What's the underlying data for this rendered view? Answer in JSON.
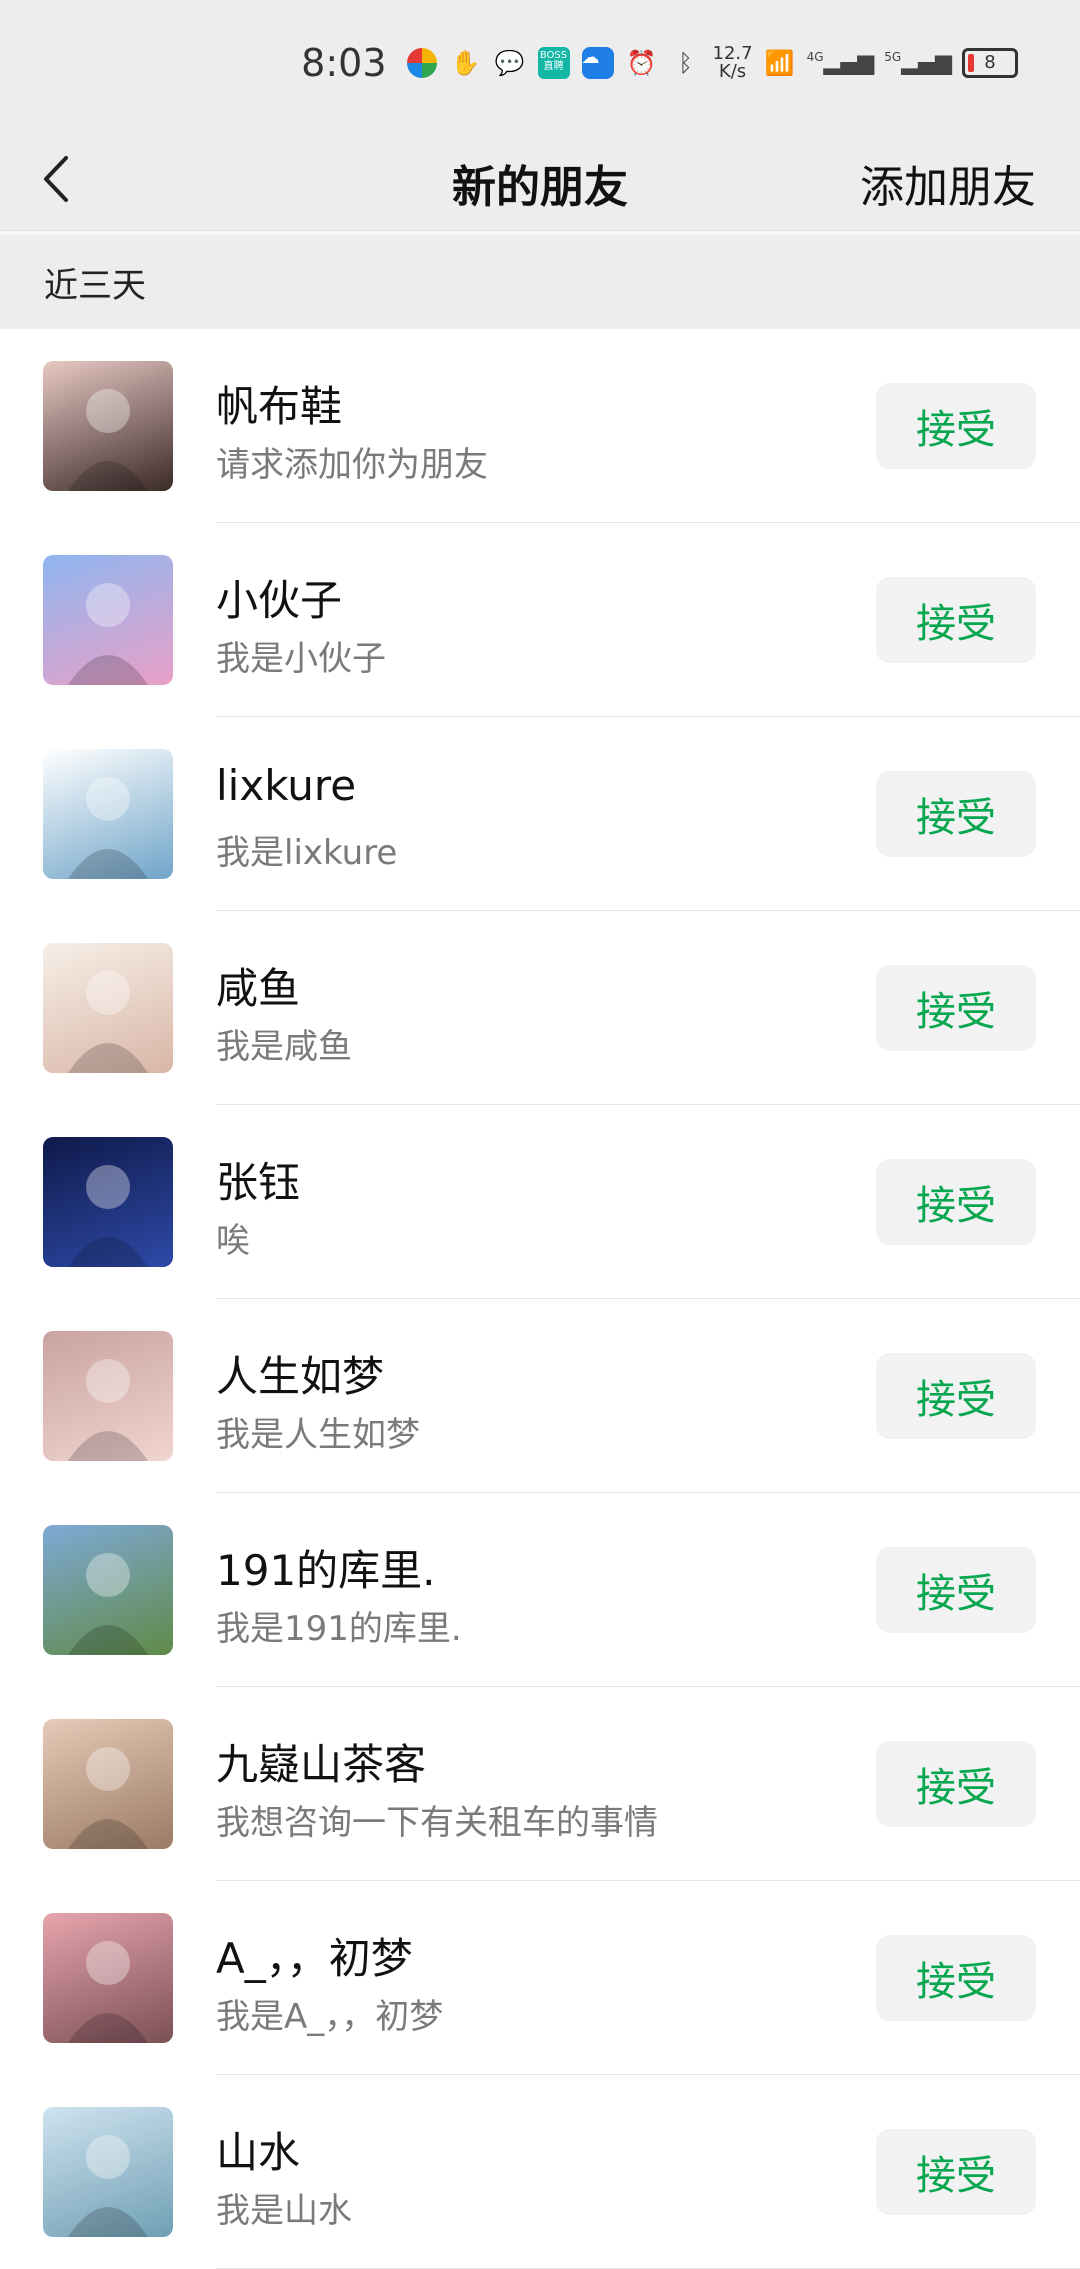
{
  "status_bar": {
    "time": "8:03",
    "net_speed_value": "12.7",
    "net_speed_unit": "K/s",
    "net_4g": "4G",
    "net_5g": "5G",
    "battery_level": "8",
    "boss_label": "BOSS直聘"
  },
  "nav": {
    "title": "新的朋友",
    "action_label": "添加朋友"
  },
  "section": {
    "label": "近三天"
  },
  "accept_label": "接受",
  "requests": [
    {
      "name": "帆布鞋",
      "message": "请求添加你为朋友",
      "avatar": "girl-portrait",
      "colors": [
        "#e8c9c4",
        "#3b2a28"
      ]
    },
    {
      "name": "小伙子",
      "message": "我是小伙子",
      "avatar": "rabbit-figure",
      "colors": [
        "#8fb6f0",
        "#e9a0c8"
      ]
    },
    {
      "name": "lixkure",
      "message": "我是lixkure",
      "avatar": "phone-case",
      "colors": [
        "#ffffff",
        "#6fa4c9"
      ]
    },
    {
      "name": "咸鱼",
      "message": "我是咸鱼",
      "avatar": "illustrated-girl",
      "colors": [
        "#f6efe7",
        "#d9b6a7"
      ]
    },
    {
      "name": "张钰",
      "message": "唉",
      "avatar": "night-stars",
      "colors": [
        "#0f1a4a",
        "#2e4aa8"
      ]
    },
    {
      "name": "人生如梦",
      "message": "我是人生如梦",
      "avatar": "girl-selfie",
      "colors": [
        "#c9a3a0",
        "#f1d5d0"
      ]
    },
    {
      "name": "191的库里.",
      "message": "我是191的库里.",
      "avatar": "meadow-girl",
      "colors": [
        "#7fa9d6",
        "#5f8a47"
      ]
    },
    {
      "name": "九嶷山茶客",
      "message": "我想咨询一下有关租车的事情",
      "avatar": "girl-with-bear",
      "colors": [
        "#e6cbb8",
        "#9b7a64"
      ]
    },
    {
      "name": "A_，，初梦",
      "message": "我是A_，，初梦",
      "avatar": "pink-rocks",
      "colors": [
        "#e7a5ad",
        "#7b4f56"
      ]
    },
    {
      "name": "山水",
      "message": "我是山水",
      "avatar": "waterfall",
      "colors": [
        "#cfe3ef",
        "#6f9fb4"
      ]
    }
  ]
}
